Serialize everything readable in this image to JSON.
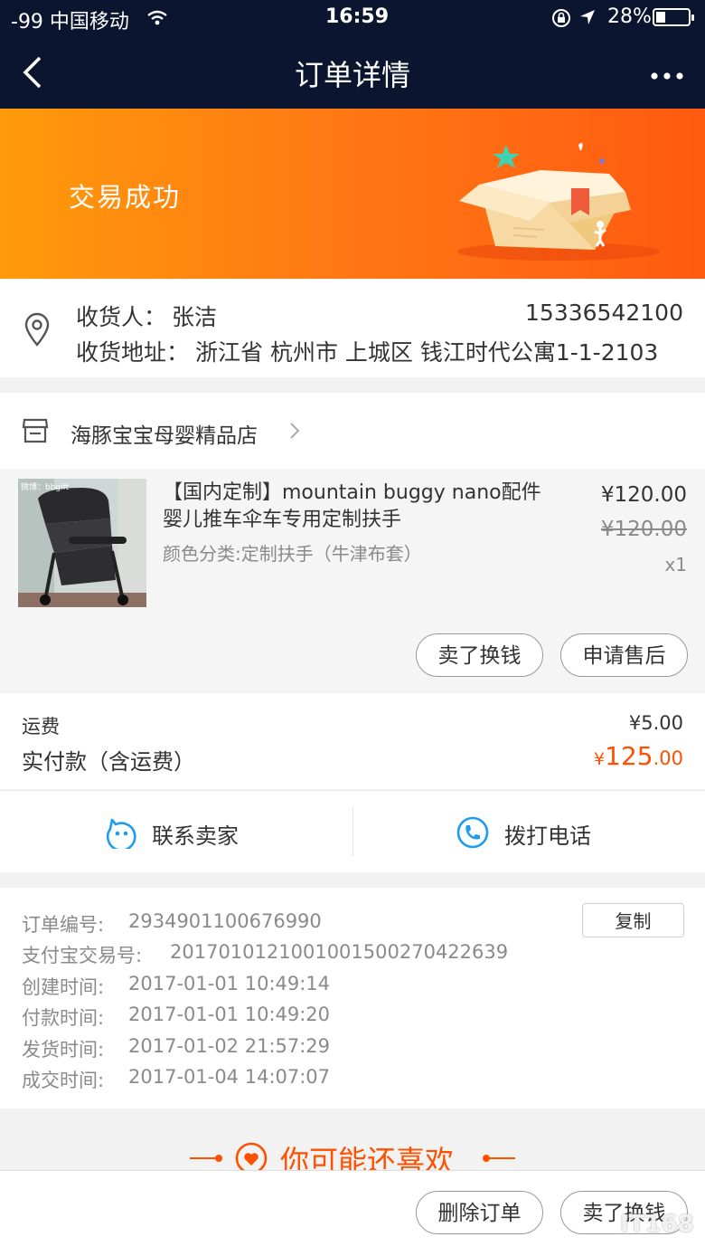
{
  "status_bar": {
    "carrier": "-99 中国移动",
    "time": "16:59",
    "battery": "28%"
  },
  "nav": {
    "title": "订单详情",
    "back_icon": "chevron-left-icon",
    "more_icon": "more-dots-icon"
  },
  "banner": {
    "status": "交易成功",
    "colors": {
      "from": "#ff9a0a",
      "to": "#ff5a10"
    }
  },
  "address": {
    "receiver_label": "收货人：",
    "receiver_name": "张洁",
    "phone": "15336542100",
    "address_label": "收货地址：",
    "address": "浙江省 杭州市 上城区 钱江时代公寓1-1-2103"
  },
  "store": {
    "name": "海豚宝宝母婴精品店"
  },
  "item": {
    "title": "【国内定制】mountain buggy nano配件婴儿推车伞车专用定制扶手",
    "sku": "颜色分类:定制扶手（牛津布套）",
    "price": "¥120.00",
    "original_price": "¥120.00",
    "qty": "x1",
    "image_watermark": "微博：bbgift",
    "buttons": {
      "sell": "卖了换钱",
      "after_sale": "申请售后"
    }
  },
  "cost": {
    "shipping_label": "运费",
    "shipping_value": "¥5.00",
    "paid_label": "实付款（含运费）",
    "paid_currency": "¥",
    "paid_int": "125",
    "paid_dec": ".00",
    "accent": "#ff5000"
  },
  "contact": {
    "seller": "联系卖家",
    "phone": "拨打电话"
  },
  "order_info": {
    "copy_label": "复制",
    "rows": [
      {
        "label": "订单编号:",
        "value": "2934901100676990"
      },
      {
        "label": "支付宝交易号:",
        "value": "2017010121001001500270422639"
      },
      {
        "label": "创建时间:",
        "value": "2017-01-01 10:49:14"
      },
      {
        "label": "付款时间:",
        "value": "2017-01-01 10:49:20"
      },
      {
        "label": "发货时间:",
        "value": "2017-01-02 21:57:29"
      },
      {
        "label": "成交时间:",
        "value": "2017-01-04 14:07:07"
      }
    ]
  },
  "recommend": {
    "title": "你可能还喜欢"
  },
  "bottom_bar": {
    "delete": "删除订单",
    "sell": "卖了换钱"
  },
  "watermark": {
    "text": "IT168"
  }
}
